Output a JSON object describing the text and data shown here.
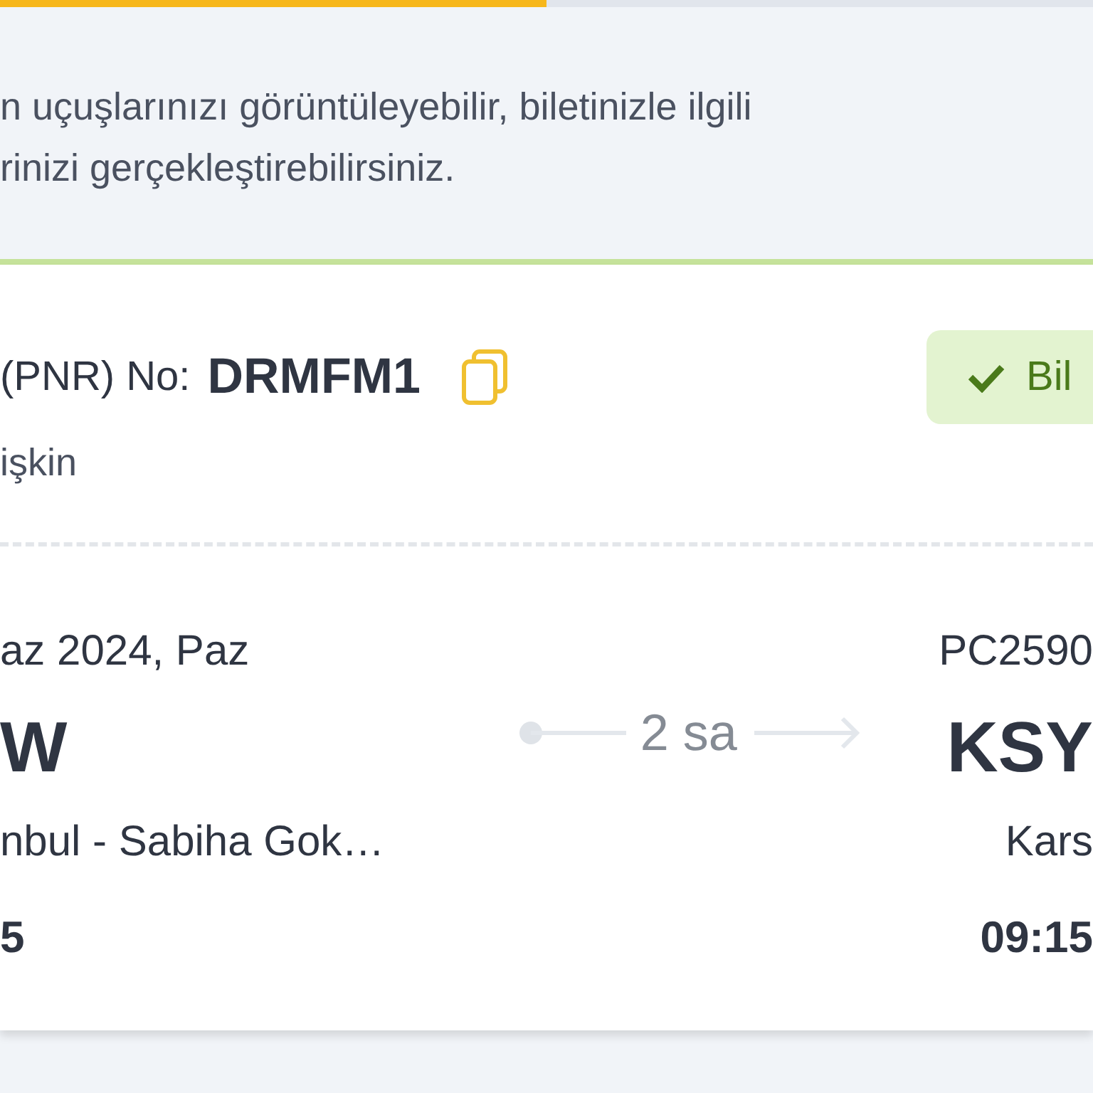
{
  "progress": {
    "level": 0.5
  },
  "info": {
    "text": "n uçuşlarınızı görüntüleyebilir, biletinizle ilgili\nrinizi gerçekleştirebilirsiniz."
  },
  "booking": {
    "pnr_label": "(PNR) No:",
    "pnr": "DRMFM1",
    "status": "Bil",
    "passenger": "işkin"
  },
  "flight": {
    "date": "az 2024, Paz",
    "flight_number": "PC2590",
    "duration": "2 sa",
    "origin": {
      "code": "W",
      "name": "nbul - Sabiha Gok…",
      "time": "5"
    },
    "destination": {
      "code": "KSY",
      "name": "Kars",
      "time": "09:15"
    }
  }
}
